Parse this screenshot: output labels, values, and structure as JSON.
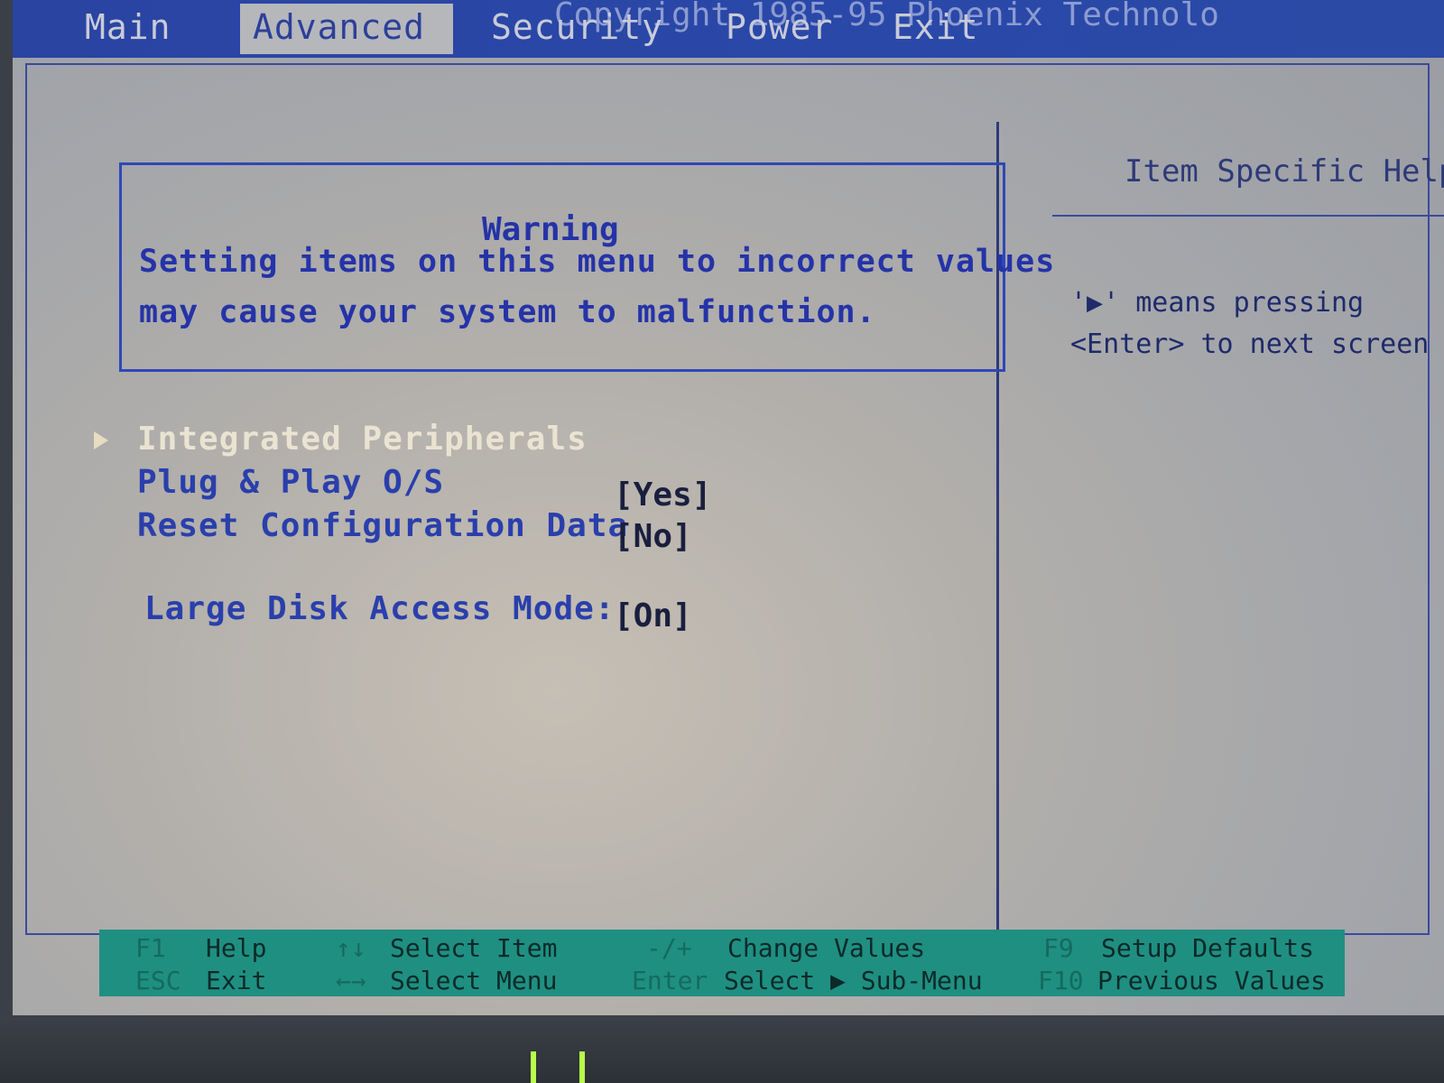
{
  "tabs": [
    "Main",
    "Advanced",
    "Security",
    "Power",
    "Exit"
  ],
  "active_tab": "Advanced",
  "copyright": "Copyright 1985-95 Phoenix Technolo",
  "warning": {
    "title": "Warning",
    "line1": "Setting items on this menu to incorrect values",
    "line2": "may cause your system to malfunction."
  },
  "menu": [
    {
      "label": "Integrated Peripherals",
      "value": ""
    },
    {
      "label": "Plug & Play O/S",
      "value": "[Yes]"
    },
    {
      "label": "Reset Configuration Data",
      "value": "[No]"
    },
    {
      "label": "Large Disk Access Mode:",
      "value": "[On]"
    }
  ],
  "help": {
    "title": "Item Specific Help",
    "line1": "'▶' means pressing",
    "line2": "<Enter> to next screen"
  },
  "footer": {
    "row1": [
      {
        "key": "F1",
        "desc": "Help"
      },
      {
        "key": "↑↓",
        "desc": "Select Item"
      },
      {
        "key": "-/+",
        "desc": "Change Values"
      },
      {
        "key": "F9",
        "desc": "Setup Defaults"
      }
    ],
    "row2": [
      {
        "key": "ESC",
        "desc": "Exit"
      },
      {
        "key": "←→",
        "desc": "Select Menu"
      },
      {
        "key": "Enter",
        "desc": "Select ▶ Sub-Menu"
      },
      {
        "key": "F10",
        "desc": "Previous Values"
      }
    ]
  },
  "colors": {
    "menu_bar": "#2a44a2",
    "footer_bar": "#1f8f82",
    "text_blue": "#2a3fac"
  }
}
